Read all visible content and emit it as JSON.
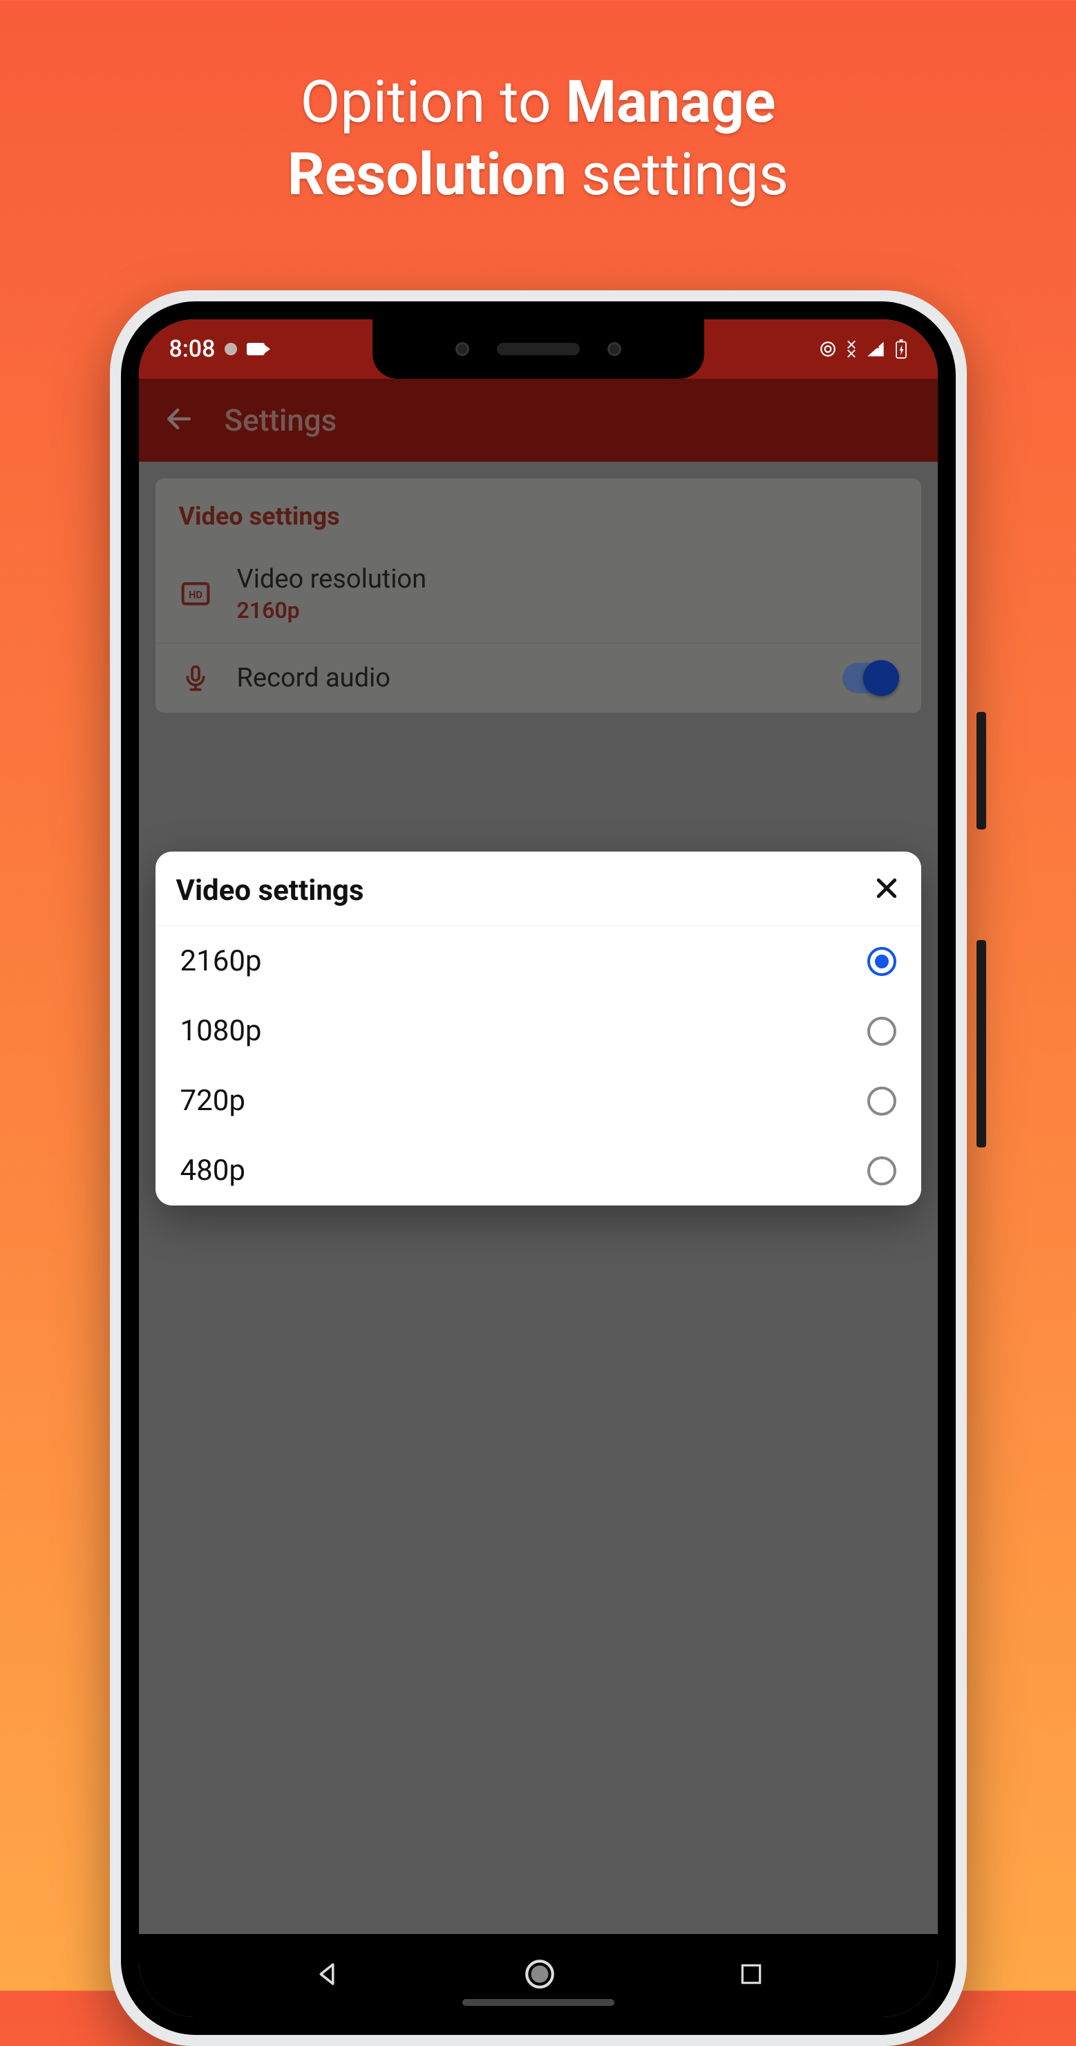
{
  "promo": {
    "line1_light": "Opition to ",
    "line1_bold": "Manage",
    "line2_bold": "Resolution",
    "line2_light": " settings"
  },
  "statusbar": {
    "time": "8:08"
  },
  "appbar": {
    "title": "Settings"
  },
  "settings": {
    "section_title": "Video settings",
    "video_resolution": {
      "label": "Video resolution",
      "value": "2160p"
    },
    "record_audio": {
      "label": "Record audio",
      "enabled": true
    }
  },
  "dialog": {
    "title": "Video settings",
    "selected": "2160p",
    "options": [
      "2160p",
      "1080p",
      "720p",
      "480p"
    ]
  }
}
